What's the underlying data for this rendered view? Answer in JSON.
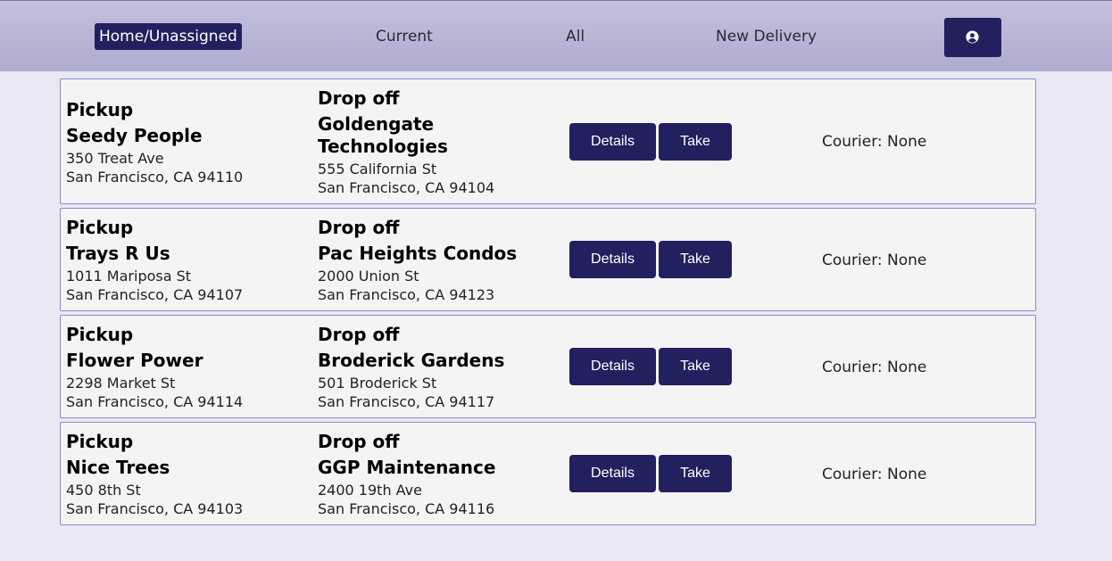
{
  "nav": {
    "home": "Home/Unassigned",
    "current": "Current",
    "all": "All",
    "new_delivery": "New Delivery",
    "account_icon": "user-circle-icon"
  },
  "colors": {
    "nav_active_bg": "#23205f",
    "button_bg": "#23205f",
    "card_border": "#8b89cf",
    "page_bg": "#e8e7f4"
  },
  "deliveries": [
    {
      "pickup_label": "Pickup",
      "pickup_name": "Seedy People",
      "pickup_street": "350 Treat Ave",
      "pickup_city": "San Francisco, CA 94110",
      "dropoff_label": "Drop off",
      "dropoff_name": "Goldengate Technologies",
      "dropoff_street": "555 California St",
      "dropoff_city": "San Francisco, CA 94104",
      "details_label": "Details",
      "take_label": "Take",
      "courier": "Courier: None"
    },
    {
      "pickup_label": "Pickup",
      "pickup_name": "Trays R Us",
      "pickup_street": "1011 Mariposa St",
      "pickup_city": "San Francisco, CA 94107",
      "dropoff_label": "Drop off",
      "dropoff_name": "Pac Heights Condos",
      "dropoff_street": "2000 Union St",
      "dropoff_city": "San Francisco, CA 94123",
      "details_label": "Details",
      "take_label": "Take",
      "courier": "Courier: None"
    },
    {
      "pickup_label": "Pickup",
      "pickup_name": "Flower Power",
      "pickup_street": "2298 Market St",
      "pickup_city": "San Francisco, CA 94114",
      "dropoff_label": "Drop off",
      "dropoff_name": "Broderick Gardens",
      "dropoff_street": "501 Broderick St",
      "dropoff_city": "San Francisco, CA 94117",
      "details_label": "Details",
      "take_label": "Take",
      "courier": "Courier: None"
    },
    {
      "pickup_label": "Pickup",
      "pickup_name": "Nice Trees",
      "pickup_street": "450 8th St",
      "pickup_city": "San Francisco, CA 94103",
      "dropoff_label": "Drop off",
      "dropoff_name": "GGP Maintenance",
      "dropoff_street": "2400 19th Ave",
      "dropoff_city": "San Francisco, CA 94116",
      "details_label": "Details",
      "take_label": "Take",
      "courier": "Courier: None"
    }
  ]
}
